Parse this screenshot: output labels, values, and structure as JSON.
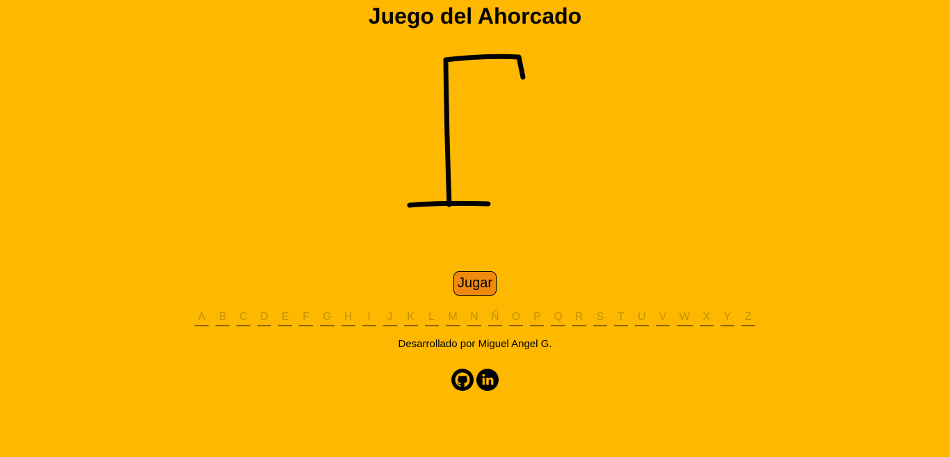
{
  "title": "Juego del Ahorcado",
  "play_button": "Jugar",
  "letters": [
    "A",
    "B",
    "C",
    "D",
    "E",
    "F",
    "G",
    "H",
    "I",
    "J",
    "K",
    "L",
    "M",
    "N",
    "Ñ",
    "O",
    "P",
    "Q",
    "R",
    "S",
    "T",
    "U",
    "V",
    "W",
    "X",
    "Y",
    "Z"
  ],
  "credit": "Desarrollado por Miguel Angel G.",
  "socials": [
    {
      "icon": "github-icon"
    },
    {
      "icon": "linkedin-icon"
    }
  ],
  "colors": {
    "background": "#ffb800",
    "button": "#f08a0c",
    "letter_inactive": "#c49000",
    "ink": "#000000"
  }
}
